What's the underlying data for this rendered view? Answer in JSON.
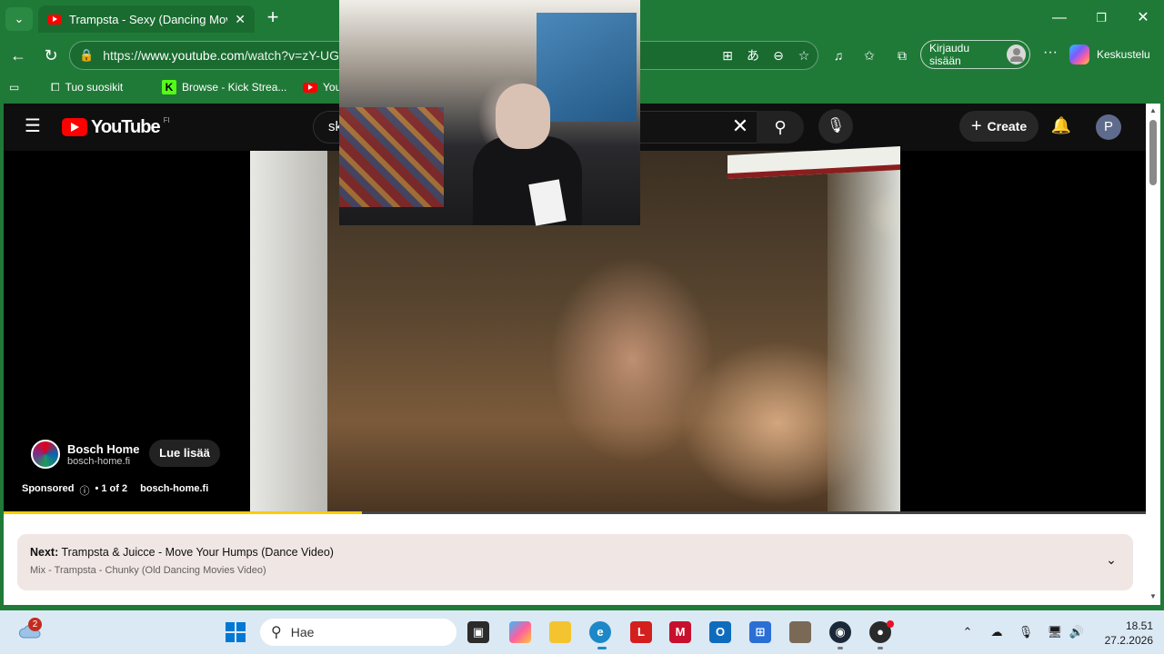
{
  "browser": {
    "tab_title": "Trampsta - Sexy (Dancing Movies",
    "url_prefix": "https://",
    "url_domain": "www.youtube.com",
    "url_rest": "/watch?v=zY-UG",
    "signin_label": "Kirjaudu sisään",
    "copilot_label": "Keskustelu",
    "bookmarks": [
      {
        "label": "Tuo suosikit",
        "icon": "import-favorites-icon"
      },
      {
        "label": "Browse - Kick Strea...",
        "icon": "kick-icon"
      },
      {
        "label": "You",
        "icon": "youtube-icon"
      }
    ]
  },
  "youtube": {
    "logo_text": "YouTube",
    "country_code": "FI",
    "search_value": "sk",
    "create_label": "Create",
    "avatar_letter": "P"
  },
  "ad": {
    "channel_name": "Bosch Home",
    "domain": "bosch-home.fi",
    "cta_label": "Lue lisää",
    "sponsored_label": "Sponsored",
    "count_label": "• 1 of 2",
    "sponsor_domain": "bosch-home.fi",
    "progress_fraction": 0.314
  },
  "up_next": {
    "prefix": "Next:",
    "title": "Trampsta & Juicce - Move Your Humps (Dance Video)",
    "mix_line": "Mix - Trampsta - Chunky (Old Dancing Movies Video)"
  },
  "taskbar": {
    "weather_badge": "2",
    "search_placeholder": "Hae",
    "clock_time": "18.51",
    "clock_date": "27.2.2026"
  },
  "colors": {
    "browser_chrome": "#1f7a37",
    "youtube_red": "#ff0000",
    "progress": "#ffcc00"
  }
}
